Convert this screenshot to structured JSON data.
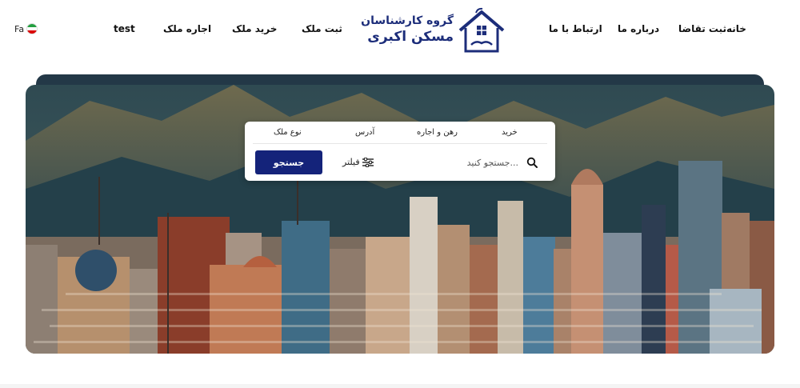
{
  "header": {
    "lang": "Fa",
    "nav": {
      "home": "خانه",
      "request": "ثبت تقاضا",
      "about": "درباره ما",
      "contact": "ارتباط با ما",
      "register": "ثبت ملک",
      "buy": "خرید ملک",
      "rent": "اجاره ملک",
      "test": "test"
    },
    "logo": {
      "line1": "گروه کارشناسان",
      "line2": "مسکن اکبری"
    }
  },
  "search": {
    "tabs": [
      "خرید",
      "رهن و اجاره",
      "آدرس",
      "نوع ملک"
    ],
    "placeholder": "جستجو کنید...",
    "filter_label": "فیلتر",
    "button_label": "جستجو"
  },
  "colors": {
    "brand": "#14237a",
    "logo": "#1c2d7a"
  }
}
